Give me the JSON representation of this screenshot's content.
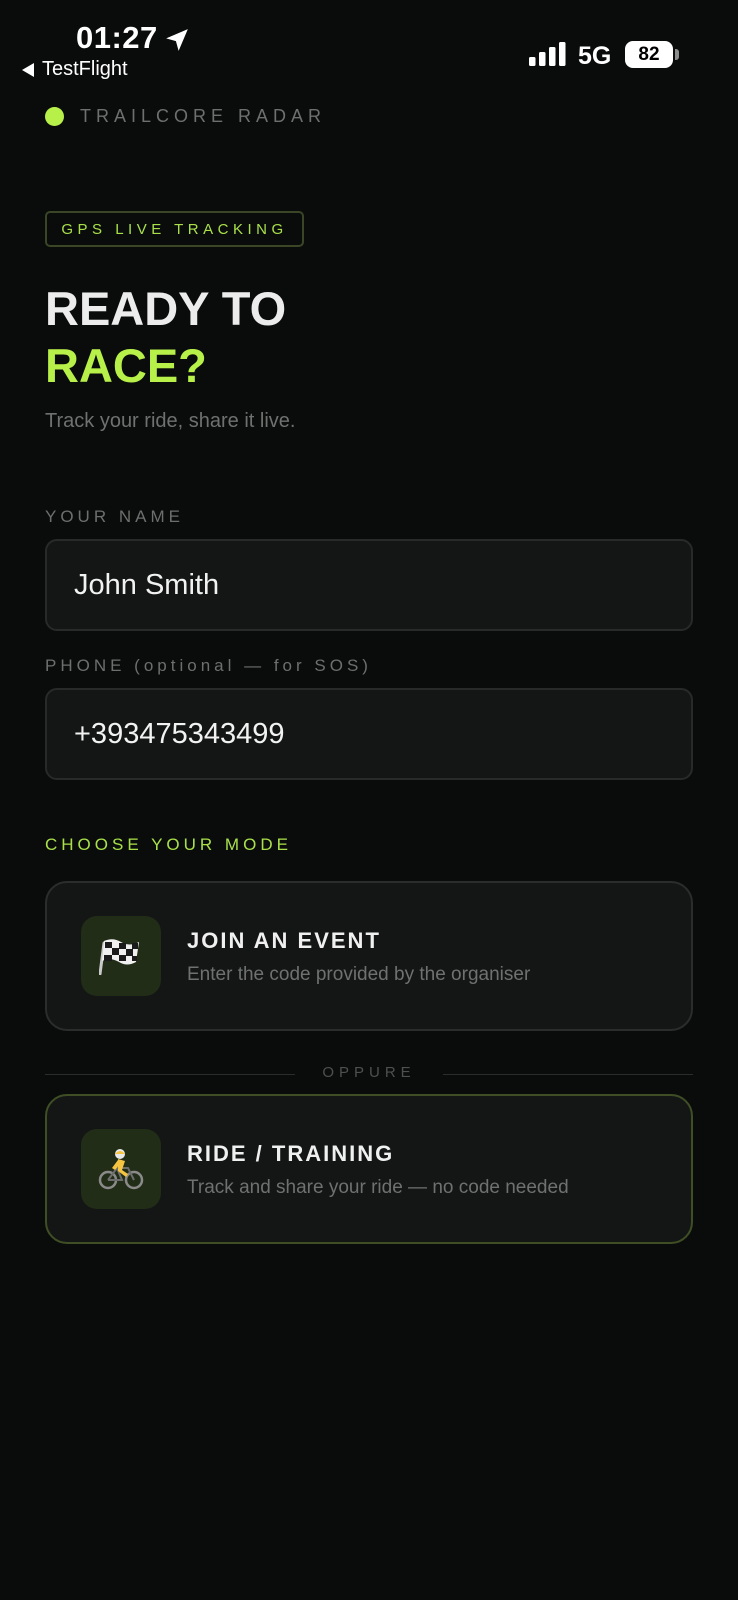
{
  "status_bar": {
    "time": "01:27",
    "back_app": "TestFlight",
    "network": "5G",
    "battery": "82"
  },
  "brand": {
    "name": "TRAILCORE RADAR",
    "accent_color": "#b8f04a"
  },
  "badge": "GPS LIVE TRACKING",
  "headline": {
    "line1": "READY TO",
    "line2": "RACE?"
  },
  "subtitle": "Track your ride, share it live.",
  "form": {
    "name_label": "YOUR NAME",
    "name_value": "John Smith",
    "phone_label": "PHONE (optional — for SOS)",
    "phone_value": "+393475343499"
  },
  "mode": {
    "section_label": "CHOOSE YOUR MODE",
    "join": {
      "icon": "checkered-flag-icon",
      "title": "JOIN AN EVENT",
      "desc": "Enter the code provided by the organiser"
    },
    "divider": "OPPURE",
    "ride": {
      "icon": "cyclist-icon",
      "title": "RIDE / TRAINING",
      "desc": "Track and share your ride — no code needed"
    }
  }
}
